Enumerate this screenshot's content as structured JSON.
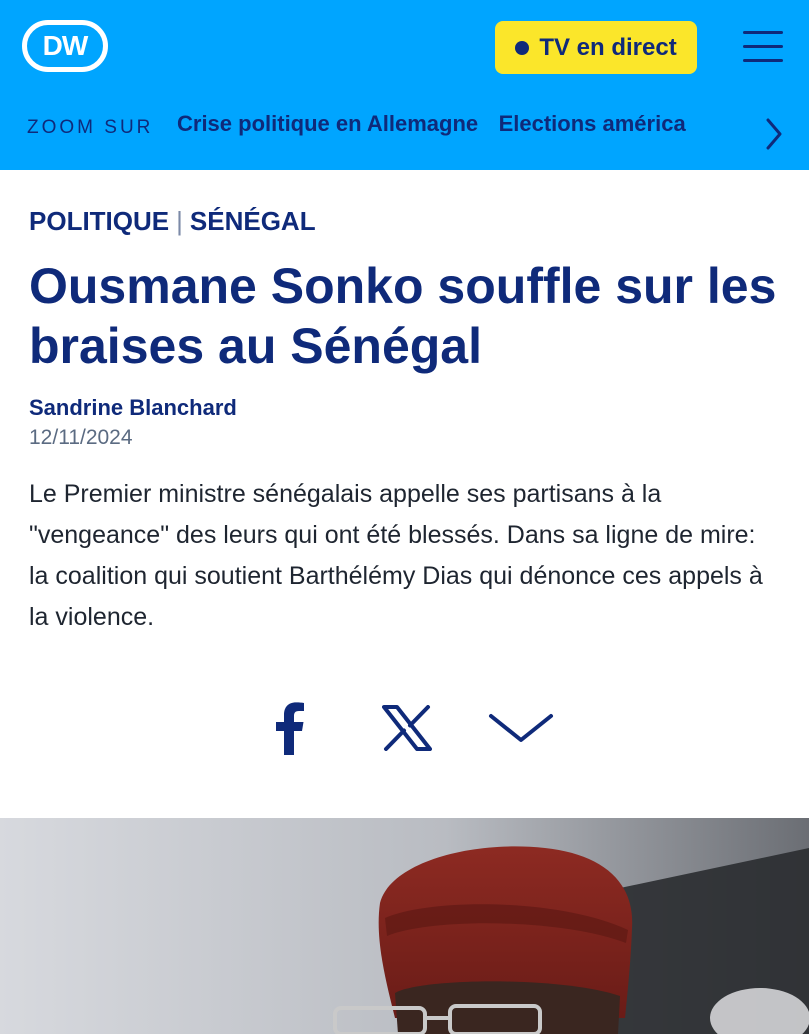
{
  "header": {
    "logo_text": "DW",
    "live_button_label": "TV en direct",
    "zoom_label": "ZOOM SUR",
    "topics": [
      "Crise politique en Allemagne",
      "Elections américa"
    ],
    "colors": {
      "background": "#00a5ff",
      "text": "#0f2a7a",
      "live_button": "#fbe62a"
    }
  },
  "article": {
    "category_1": "POLITIQUE",
    "separator": "|",
    "category_2": "SÉNÉGAL",
    "title": "Ousmane Sonko souffle sur les braises au Sénégal",
    "author": "Sandrine Blanchard",
    "date": "12/11/2024",
    "lead": "Le Premier ministre sénégalais appelle ses partisans à la \"vengeance\" des leurs qui ont été blessés. Dans sa ligne de mire: la coalition qui soutient Barthélémy Dias qui dénonce ces appels à la violence."
  },
  "share": {
    "icons": [
      "facebook-icon",
      "x-icon",
      "chevron-down-icon"
    ]
  },
  "image": {
    "description_icon": "photo"
  }
}
